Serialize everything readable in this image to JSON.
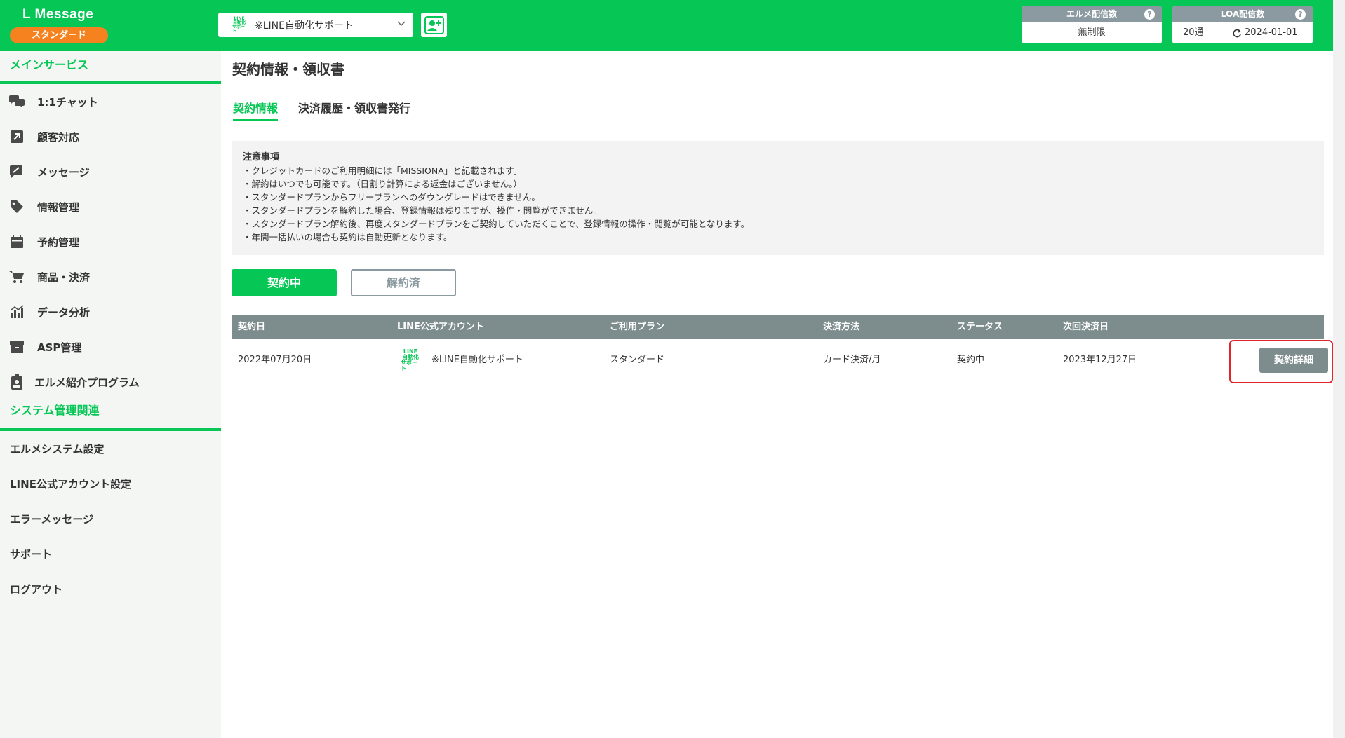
{
  "header": {
    "brand_title": "L Message",
    "plan_badge": "スタンダード",
    "account_select": {
      "logo_line1": "LINE",
      "logo_line2": "自動化",
      "logo_line3": "サポート",
      "value": "※LINE自動化サポート"
    },
    "elme_stat": {
      "label": "エルメ配信数",
      "value": "無制限",
      "help": "?"
    },
    "loa_stat": {
      "label": "LOA配信数",
      "count": "20通",
      "date": "2024-01-01",
      "help": "?"
    }
  },
  "sidebar": {
    "main_section": "メインサービス",
    "main_items": [
      {
        "label": "1:1チャット",
        "icon": "chat-icon"
      },
      {
        "label": "顧客対応",
        "icon": "external-link-icon"
      },
      {
        "label": "メッセージ",
        "icon": "message-edit-icon"
      },
      {
        "label": "情報管理",
        "icon": "tag-icon"
      },
      {
        "label": "予約管理",
        "icon": "calendar-icon"
      },
      {
        "label": "商品・決済",
        "icon": "cart-icon"
      },
      {
        "label": "データ分析",
        "icon": "chart-icon"
      },
      {
        "label": "ASP管理",
        "icon": "archive-icon"
      },
      {
        "label": "エルメ紹介プログラム",
        "icon": "id-badge-icon"
      }
    ],
    "system_section": "システム管理関連",
    "system_items": [
      {
        "label": "エルメシステム設定"
      },
      {
        "label": "LINE公式アカウント設定"
      },
      {
        "label": "エラーメッセージ"
      },
      {
        "label": "サポート"
      },
      {
        "label": "ログアウト"
      }
    ]
  },
  "main": {
    "page_title": "契約情報・領収書",
    "tabs": [
      {
        "label": "契約情報",
        "active": true
      },
      {
        "label": "決済履歴・領収書発行",
        "active": false
      }
    ],
    "notice": {
      "title": "注意事項",
      "lines": [
        "・クレジットカードのご利用明細には「MISSIONA」と記載されます。",
        "・解約はいつでも可能です。（日割り計算による返金はございません。）",
        "・スタンダードプランからフリープランへのダウングレードはできません。",
        "・スタンダードプランを解約した場合、登録情報は残りますが、操作・閲覧ができません。",
        "・スタンダードプラン解約後、再度スタンダードプランをご契約していただくことで、登録情報の操作・閲覧が可能となります。",
        "・年間一括払いの場合も契約は自動更新となります。"
      ]
    },
    "filter": {
      "active_label": "契約中",
      "cancelled_label": "解約済"
    },
    "table": {
      "headers": [
        "契約日",
        "LINE公式アカウント",
        "ご利用プラン",
        "決済方法",
        "ステータス",
        "次回決済日"
      ],
      "row": {
        "date": "2022年07月20日",
        "logo_line1": "LINE",
        "logo_line2": "自動化",
        "logo_line3": "サポート",
        "account": "※LINE自動化サポート",
        "plan": "スタンダード",
        "payment": "カード決済/月",
        "status": "契約中",
        "next_date": "2023年12月27日",
        "detail_button": "契約詳細"
      }
    }
  },
  "colors": {
    "brand_green": "#06c755",
    "badge_orange": "#f6821f",
    "header_gray": "#7d8c8d",
    "highlight_red": "#e0262b"
  }
}
